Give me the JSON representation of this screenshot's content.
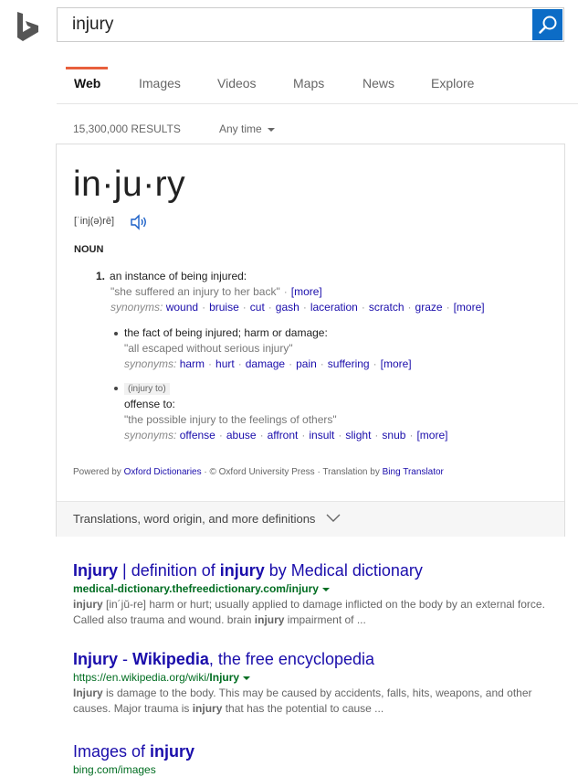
{
  "search": {
    "query": "injury"
  },
  "tabs": [
    {
      "label": "Web"
    },
    {
      "label": "Images"
    },
    {
      "label": "Videos"
    },
    {
      "label": "Maps"
    },
    {
      "label": "News"
    },
    {
      "label": "Explore"
    }
  ],
  "results_count": "15,300,000 RESULTS",
  "time_filter": "Any time",
  "dictionary": {
    "headword": "in·ju·ry",
    "pronunciation": "[ˈinj(ə)rē]",
    "part_of_speech": "NOUN",
    "def1": {
      "num": "1.",
      "text": "an instance of being injured:",
      "example": "\"she suffered an injury to her back\"",
      "more_label": "[more]",
      "syn_label": "synonyms:",
      "synonyms": [
        "wound",
        "bruise",
        "cut",
        "gash",
        "laceration",
        "scratch",
        "graze"
      ],
      "syn_more": "[more]"
    },
    "def2": {
      "text": "the fact of being injured; harm or damage:",
      "example": "\"all escaped without serious injury\"",
      "syn_label": "synonyms:",
      "synonyms": [
        "harm",
        "hurt",
        "damage",
        "pain",
        "suffering"
      ],
      "syn_more": "[more]"
    },
    "def3": {
      "tag": "(injury to)",
      "text": "offense to:",
      "example": "\"the possible injury to the feelings of others\"",
      "syn_label": "synonyms:",
      "synonyms": [
        "offense",
        "abuse",
        "affront",
        "insult",
        "slight",
        "snub"
      ],
      "syn_more": "[more]"
    },
    "credit": {
      "powered": "Powered by",
      "oxford": "Oxford Dictionaries",
      "middle": " · © Oxford University Press · Translation by",
      "bing": "Bing Translator"
    },
    "footer": "Translations, word origin, and more definitions"
  },
  "results": [
    {
      "title_pre": "Injury",
      "title_mid": " | definition of ",
      "title_bold2": "injury",
      "title_post": " by Medical dictionary",
      "url_pre": "medical-dictionary.thefreedictionary.com/",
      "url_bold": "injury",
      "snippet_bold1": "injury",
      "snippet_1": " [in´jŭ-re] harm or hurt; usually applied to damage inflicted on the body by an external force. Called also trauma and wound. brain ",
      "snippet_bold2": "injury",
      "snippet_2": " impairment of ..."
    },
    {
      "title_pre": "Injury",
      "title_mid": " - ",
      "title_bold2": "Wikipedia",
      "title_post": ", the free encyclopedia",
      "url_pre": "https://en.wikipedia.org/wiki/",
      "url_bold": "Injury",
      "snippet_bold1": "Injury",
      "snippet_1": " is damage to the body. This may be caused by accidents, falls, hits, weapons, and other causes. Major trauma is ",
      "snippet_bold2": "injury",
      "snippet_2": " that has the potential to cause ..."
    },
    {
      "title_pre": "Images of ",
      "title_bold2": "injury",
      "url": "bing.com/images"
    }
  ],
  "colors": {
    "accent": "#0c6cc6",
    "tab_indicator": "#e8603c",
    "link": "#1a0dab",
    "url": "#006d21"
  }
}
